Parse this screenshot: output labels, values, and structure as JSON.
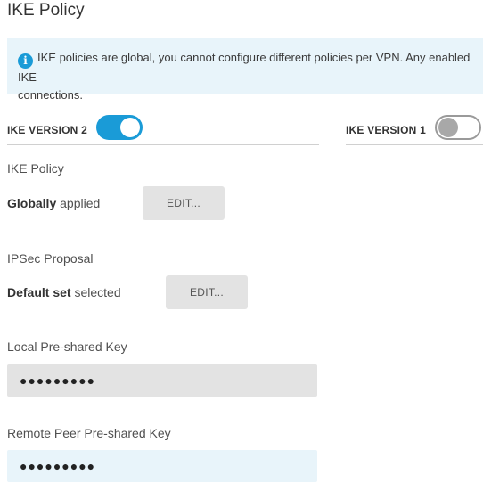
{
  "page": {
    "title": "IKE Policy"
  },
  "info": {
    "icon": "info-icon",
    "line1": "IKE policies are global, you cannot configure different policies per VPN. Any enabled IKE",
    "line2": "connections."
  },
  "ike_versions": {
    "v2": {
      "label": "IKE VERSION 2",
      "enabled": true
    },
    "v1": {
      "label": "IKE VERSION 1",
      "enabled": false
    },
    "accent_color": "#1a9bd7"
  },
  "ike_policy": {
    "label": "IKE Policy",
    "status_bold": "Globally",
    "status_rest": " applied",
    "edit_label": "EDIT..."
  },
  "ipsec_proposal": {
    "label": "IPSec Proposal",
    "status_bold": "Default set",
    "status_rest": " selected",
    "edit_label": "EDIT..."
  },
  "local_key": {
    "label": "Local Pre-shared Key",
    "value": "●●●●●●●●●"
  },
  "remote_key": {
    "label": "Remote Peer Pre-shared Key",
    "value": "●●●●●●●●●"
  }
}
